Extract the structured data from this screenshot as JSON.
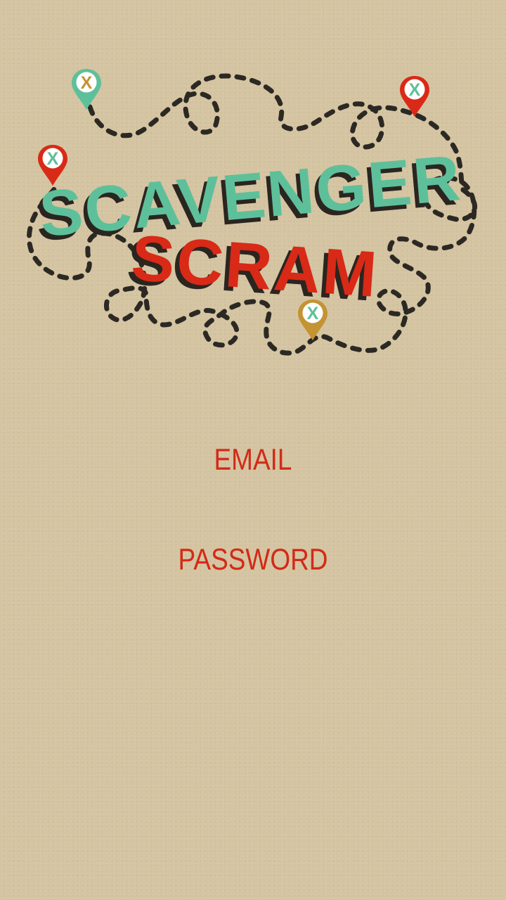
{
  "logo": {
    "line1": "SCAVENGER",
    "line2": "SCRAM",
    "line1_color": "#5ec09a",
    "line2_color": "#d82a17",
    "trail_color": "#2c2924",
    "pins": [
      {
        "color": "#5ec09a",
        "mark": "X",
        "mark_color": "#c49333"
      },
      {
        "color": "#d82a17",
        "mark": "X",
        "mark_color": "#5ec09a"
      },
      {
        "color": "#d82a17",
        "mark": "X",
        "mark_color": "#5ec09a"
      },
      {
        "color": "#c49333",
        "mark": "X",
        "mark_color": "#5ec09a"
      }
    ]
  },
  "form": {
    "email_label": "EMAIL",
    "email_value": "",
    "password_label": "PASSWORD",
    "password_value": ""
  },
  "theme": {
    "background": "#d4c4a1",
    "label_color": "#d32a17"
  }
}
